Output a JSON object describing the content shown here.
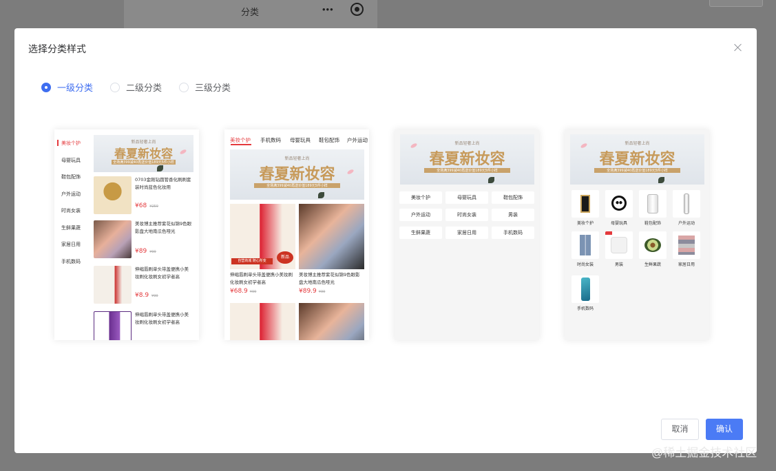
{
  "background": {
    "label": "分类",
    "dots": "•••"
  },
  "dialog": {
    "title": "选择分类样式"
  },
  "style_options": [
    {
      "label": "一级分类",
      "selected": true
    },
    {
      "label": "二级分类",
      "selected": false
    },
    {
      "label": "三级分类",
      "selected": false
    }
  ],
  "banner": {
    "subtitle": "新品轻奢上尚",
    "title": "春夏新妆容",
    "promo": "全场满399减40再送价值189元5件小样"
  },
  "card1": {
    "categories": [
      "美妆个护",
      "母婴玩具",
      "鞋包配饰",
      "户外运动",
      "时尚女装",
      "生鲜果蔬",
      "家居日用",
      "手机数码"
    ],
    "products": [
      {
        "name": "0703金刚钻圆管香化刷刷套装时尚蓝色化妆用",
        "price": "¥68",
        "old": "¥259"
      },
      {
        "name": "美妆博主推荐紫花似锦9色眼影盘大地南瓜色哑光",
        "price": "¥89",
        "old": "¥99"
      },
      {
        "name": "伸缩唇刷单头带盖便携小美妆刷化妆刷女初学者高",
        "price": "¥8.9",
        "old": "¥99"
      },
      {
        "name": "伸缩唇刷单头带盖便携小美妆刷化妆刷女初学者高",
        "price": "",
        "old": ""
      }
    ]
  },
  "card2": {
    "tabs": [
      "美妆个护",
      "手机数码",
      "母婴玩具",
      "鞋包配饰",
      "户外运动"
    ],
    "products": [
      {
        "name": "伸缩唇刷单头带盖便携小美妆刷化妆刷女初学者高",
        "price": "¥68.9",
        "old": "¥99",
        "badge": "新品",
        "tag": "自营商城 随心所变"
      },
      {
        "name": "美妆博主推荐紫花似锦9色眼影盘大地南瓜色哑光",
        "price": "¥89.9",
        "old": "¥99"
      }
    ]
  },
  "card3": {
    "buttons": [
      "美妆个护",
      "母婴玩具",
      "鞋包配饰",
      "户外运动",
      "时尚女装",
      "男装",
      "生鲜果蔬",
      "家居日用",
      "手机数码"
    ]
  },
  "card4": {
    "items": [
      "美妆个护",
      "母婴玩具",
      "鞋包配饰",
      "户外运动",
      "时尚女装",
      "男装",
      "生鲜果蔬",
      "家居日用",
      "手机数码"
    ]
  },
  "buttons": {
    "cancel": "取消",
    "confirm": "确认"
  },
  "watermark": "@稀土掘金技术社区",
  "colors": {
    "primary": "#3f6ef0",
    "price_red": "#e4393c",
    "gold": "#c79a5a"
  }
}
